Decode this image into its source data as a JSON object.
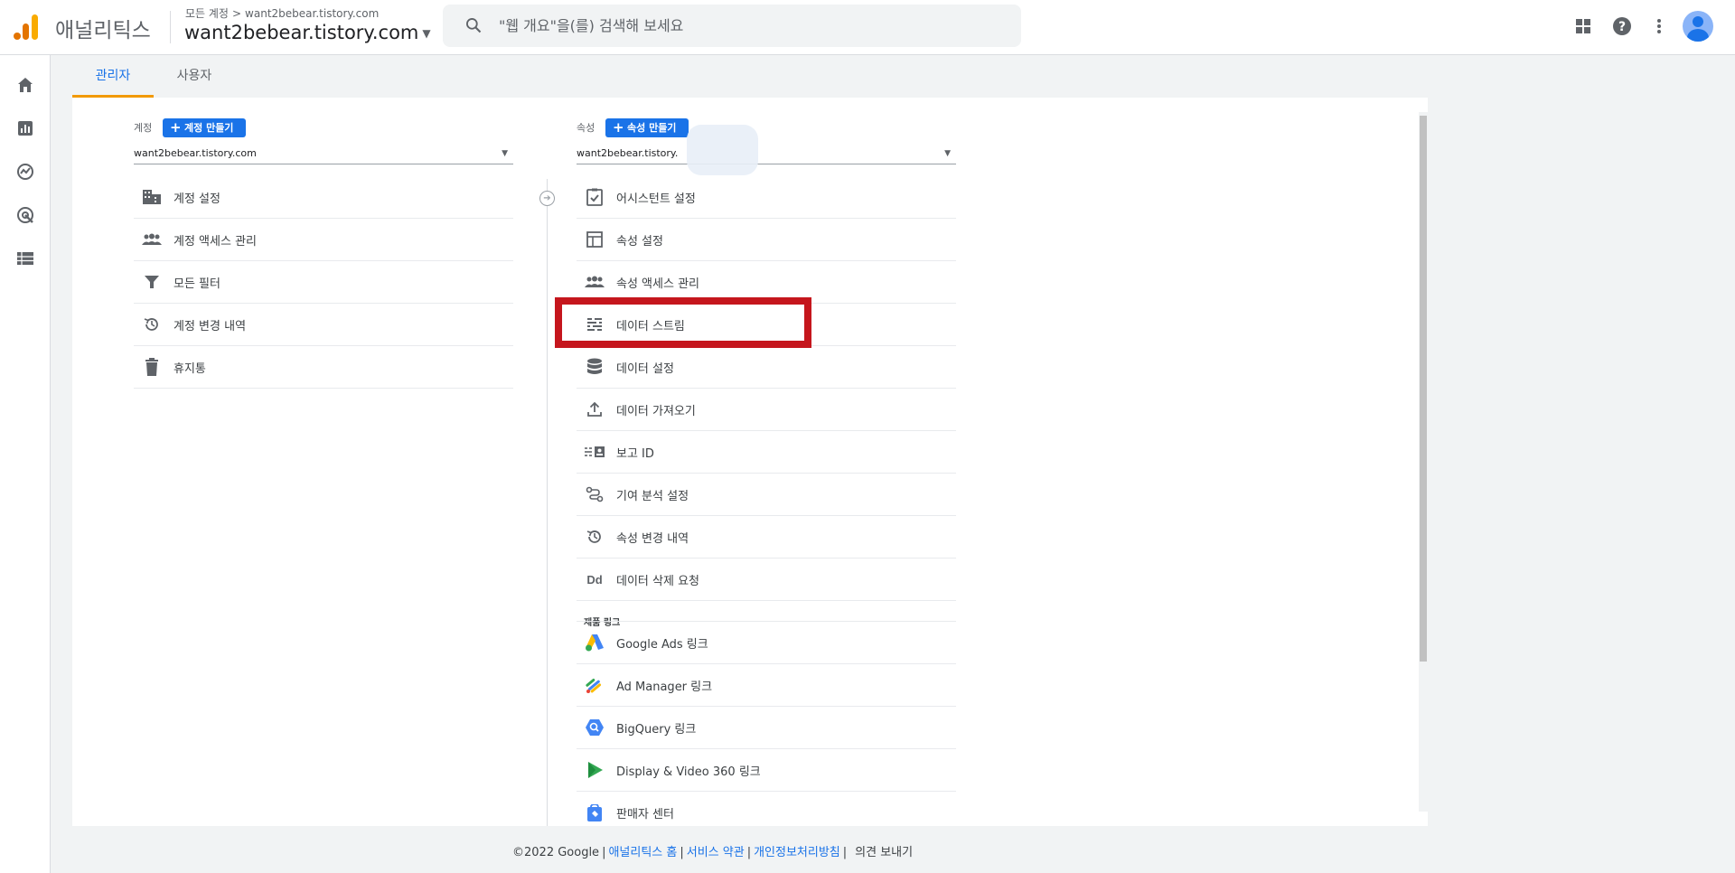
{
  "header": {
    "app_name": "애널리틱스",
    "breadcrumb_root": "모든 계정",
    "breadcrumb_chevron": ">",
    "breadcrumb_account": "want2bebear.tistory.com",
    "account_title": "want2bebear.tistory.com",
    "search_placeholder": "\"웹 개요\"을(를) 검색해 보세요"
  },
  "tabs": [
    {
      "label": "관리자",
      "active": true
    },
    {
      "label": "사용자",
      "active": false
    }
  ],
  "account_column": {
    "label": "계정",
    "create_button": "계정 만들기",
    "selected": "want2bebear.tistory.com",
    "items": [
      {
        "label": "계정 설정",
        "icon": "building-icon"
      },
      {
        "label": "계정 액세스 관리",
        "icon": "people-icon"
      },
      {
        "label": "모든 필터",
        "icon": "filter-icon"
      },
      {
        "label": "계정 변경 내역",
        "icon": "history-icon"
      },
      {
        "label": "휴지통",
        "icon": "trash-icon"
      }
    ]
  },
  "property_column": {
    "label": "속성",
    "create_button": "속성 만들기",
    "selected": "want2bebear.tistory.",
    "items": [
      {
        "label": "어시스턴트 설정",
        "icon": "checklist-icon"
      },
      {
        "label": "속성 설정",
        "icon": "layout-icon"
      },
      {
        "label": "속성 액세스 관리",
        "icon": "people-icon"
      },
      {
        "label": "데이터 스트림",
        "icon": "streams-icon"
      },
      {
        "label": "데이터 설정",
        "icon": "database-icon"
      },
      {
        "label": "데이터 가져오기",
        "icon": "upload-icon"
      },
      {
        "label": "보고 ID",
        "icon": "report-id-icon"
      },
      {
        "label": "기여 분석 설정",
        "icon": "attribution-icon"
      },
      {
        "label": "속성 변경 내역",
        "icon": "history-icon"
      },
      {
        "label": "데이터 삭제 요청",
        "icon": "dd-icon"
      }
    ],
    "links_section": "제품 링크",
    "links": [
      {
        "label": "Google Ads 링크",
        "icon": "google-ads-icon"
      },
      {
        "label": "Ad Manager 링크",
        "icon": "ad-manager-icon"
      },
      {
        "label": "BigQuery 링크",
        "icon": "bigquery-icon"
      },
      {
        "label": "Display & Video 360 링크",
        "icon": "dv360-icon"
      },
      {
        "label": "판매자 센터",
        "icon": "merchant-center-icon"
      }
    ]
  },
  "footer": {
    "copyright": "©2022 Google",
    "sep": "|",
    "link_home": "애널리틱스 홈",
    "link_terms": "서비스 약관",
    "link_privacy": "개인정보처리방침",
    "feedback": "의견 보내기"
  },
  "colors": {
    "accent": "#1a73e8",
    "tab_indicator": "#f29900",
    "highlight_box": "#c5161d"
  }
}
